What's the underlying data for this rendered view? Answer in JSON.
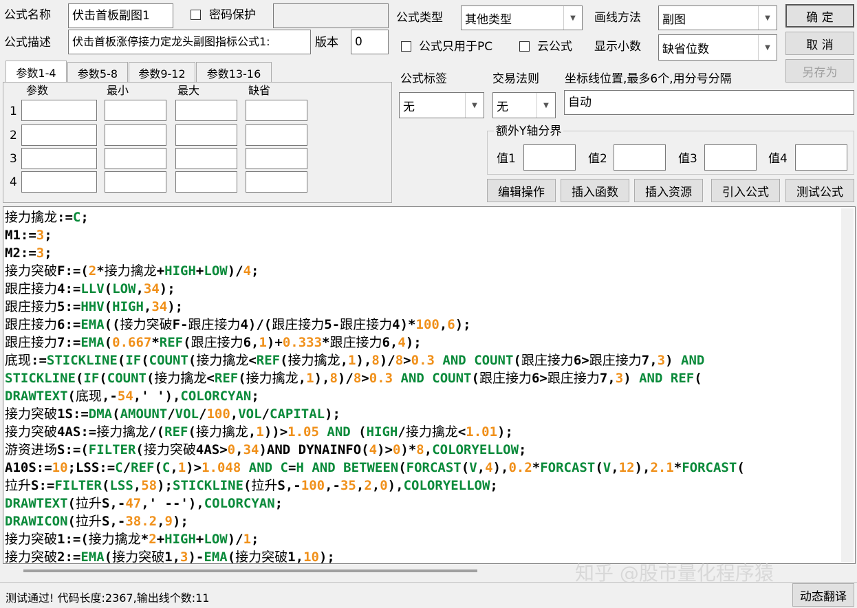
{
  "form": {
    "name_label": "公式名称",
    "name_value": "伏击首板副图1",
    "password_label": "密码保护",
    "desc_label": "公式描述",
    "desc_value": "伏击首板涨停接力定龙头副图指标公式1:",
    "version_label": "版本",
    "version_value": "0",
    "type_label": "公式类型",
    "type_value": "其他类型",
    "draw_label": "画线方法",
    "draw_value": "副图",
    "pc_only_label": "公式只用于PC",
    "cloud_label": "云公式",
    "decimal_label": "显示小数",
    "decimal_value": "缺省位数",
    "tag_label": "公式标签",
    "tag_value": "无",
    "trade_label": "交易法则",
    "trade_value": "无",
    "coord_label": "坐标线位置,最多6个,用分号分隔",
    "coord_value": "自动",
    "yaxis_title": "额外Y轴分界",
    "yaxis_labels": [
      "值1",
      "值2",
      "值3",
      "值4"
    ]
  },
  "buttons": {
    "ok": "确  定",
    "cancel": "取  消",
    "save_as": "另存为",
    "edit_ops": "编辑操作",
    "insert_func": "插入函数",
    "insert_res": "插入资源",
    "import_formula": "引入公式",
    "test_formula": "测试公式",
    "dynamic_translate": "动态翻译"
  },
  "params": {
    "tabs": [
      "参数1-4",
      "参数5-8",
      "参数9-12",
      "参数13-16"
    ],
    "headers": [
      "参数",
      "最小",
      "最大",
      "缺省"
    ],
    "rows": [
      "1",
      "2",
      "3",
      "4"
    ]
  },
  "code_lines": [
    [
      [
        "t",
        "接力擒龙"
      ],
      [
        "p",
        ":="
      ],
      [
        "k",
        "C"
      ],
      [
        "p",
        ";"
      ]
    ],
    [
      [
        "p",
        "M1:="
      ],
      [
        "n",
        "3"
      ],
      [
        "p",
        ";"
      ]
    ],
    [
      [
        "p",
        "M2:="
      ],
      [
        "n",
        "3"
      ],
      [
        "p",
        ";"
      ]
    ],
    [
      [
        "t",
        "接力突破"
      ],
      [
        "p",
        "F:=("
      ],
      [
        "n",
        "2"
      ],
      [
        "p",
        "*"
      ],
      [
        "t",
        "接力擒龙"
      ],
      [
        "p",
        "+"
      ],
      [
        "k",
        "HIGH"
      ],
      [
        "p",
        "+"
      ],
      [
        "k",
        "LOW"
      ],
      [
        "p",
        ")/"
      ],
      [
        "n",
        "4"
      ],
      [
        "p",
        ";"
      ]
    ],
    [
      [
        "t",
        "跟庄接力"
      ],
      [
        "p",
        "4:="
      ],
      [
        "k",
        "LLV"
      ],
      [
        "p",
        "("
      ],
      [
        "k",
        "LOW"
      ],
      [
        "p",
        ","
      ],
      [
        "n",
        "34"
      ],
      [
        "p",
        ");"
      ]
    ],
    [
      [
        "t",
        "跟庄接力"
      ],
      [
        "p",
        "5:="
      ],
      [
        "k",
        "HHV"
      ],
      [
        "p",
        "("
      ],
      [
        "k",
        "HIGH"
      ],
      [
        "p",
        ","
      ],
      [
        "n",
        "34"
      ],
      [
        "p",
        ");"
      ]
    ],
    [
      [
        "t",
        "跟庄接力"
      ],
      [
        "p",
        "6:="
      ],
      [
        "k",
        "EMA"
      ],
      [
        "p",
        "(("
      ],
      [
        "t",
        "接力突破"
      ],
      [
        "p",
        "F-"
      ],
      [
        "t",
        "跟庄接力"
      ],
      [
        "p",
        "4)/("
      ],
      [
        "t",
        "跟庄接力"
      ],
      [
        "p",
        "5-"
      ],
      [
        "t",
        "跟庄接力"
      ],
      [
        "p",
        "4)*"
      ],
      [
        "n",
        "100"
      ],
      [
        "p",
        ","
      ],
      [
        "n",
        "6"
      ],
      [
        "p",
        ");"
      ]
    ],
    [
      [
        "t",
        "跟庄接力"
      ],
      [
        "p",
        "7:="
      ],
      [
        "k",
        "EMA"
      ],
      [
        "p",
        "("
      ],
      [
        "n",
        "0.667"
      ],
      [
        "p",
        "*"
      ],
      [
        "k",
        "REF"
      ],
      [
        "p",
        "("
      ],
      [
        "t",
        "跟庄接力"
      ],
      [
        "p",
        "6,"
      ],
      [
        "n",
        "1"
      ],
      [
        "p",
        ")+"
      ],
      [
        "n",
        "0.333"
      ],
      [
        "p",
        "*"
      ],
      [
        "t",
        "跟庄接力"
      ],
      [
        "p",
        "6,"
      ],
      [
        "n",
        "4"
      ],
      [
        "p",
        ");"
      ]
    ],
    [
      [
        "t",
        "底现"
      ],
      [
        "p",
        ":="
      ],
      [
        "k",
        "STICKLINE"
      ],
      [
        "p",
        "("
      ],
      [
        "k",
        "IF"
      ],
      [
        "p",
        "("
      ],
      [
        "k",
        "COUNT"
      ],
      [
        "p",
        "("
      ],
      [
        "t",
        "接力擒龙"
      ],
      [
        "p",
        "<"
      ],
      [
        "k",
        "REF"
      ],
      [
        "p",
        "("
      ],
      [
        "t",
        "接力擒龙"
      ],
      [
        "p",
        ","
      ],
      [
        "n",
        "1"
      ],
      [
        "p",
        "),"
      ],
      [
        "n",
        "8"
      ],
      [
        "p",
        ")/"
      ],
      [
        "n",
        "8"
      ],
      [
        "p",
        ">"
      ],
      [
        "n",
        "0.3"
      ],
      [
        "p",
        " "
      ],
      [
        "k",
        "AND"
      ],
      [
        "p",
        " "
      ],
      [
        "k",
        "COUNT"
      ],
      [
        "p",
        "("
      ],
      [
        "t",
        "跟庄接力"
      ],
      [
        "p",
        "6>"
      ],
      [
        "t",
        "跟庄接力"
      ],
      [
        "p",
        "7,"
      ],
      [
        "n",
        "3"
      ],
      [
        "p",
        ") "
      ],
      [
        "k",
        "AND"
      ]
    ],
    [
      [
        "k",
        "STICKLINE"
      ],
      [
        "p",
        "("
      ],
      [
        "k",
        "IF"
      ],
      [
        "p",
        "("
      ],
      [
        "k",
        "COUNT"
      ],
      [
        "p",
        "("
      ],
      [
        "t",
        "接力擒龙"
      ],
      [
        "p",
        "<"
      ],
      [
        "k",
        "REF"
      ],
      [
        "p",
        "("
      ],
      [
        "t",
        "接力擒龙"
      ],
      [
        "p",
        ","
      ],
      [
        "n",
        "1"
      ],
      [
        "p",
        "),"
      ],
      [
        "n",
        "8"
      ],
      [
        "p",
        ")/"
      ],
      [
        "n",
        "8"
      ],
      [
        "p",
        ">"
      ],
      [
        "n",
        "0.3"
      ],
      [
        "p",
        " "
      ],
      [
        "k",
        "AND"
      ],
      [
        "p",
        " "
      ],
      [
        "k",
        "COUNT"
      ],
      [
        "p",
        "("
      ],
      [
        "t",
        "跟庄接力"
      ],
      [
        "p",
        "6>"
      ],
      [
        "t",
        "跟庄接力"
      ],
      [
        "p",
        "7,"
      ],
      [
        "n",
        "3"
      ],
      [
        "p",
        ") "
      ],
      [
        "k",
        "AND"
      ],
      [
        "p",
        " "
      ],
      [
        "k",
        "REF"
      ],
      [
        "p",
        "("
      ]
    ],
    [
      [
        "k",
        "DRAWTEXT"
      ],
      [
        "p",
        "("
      ],
      [
        "t",
        "底现"
      ],
      [
        "p",
        ",-"
      ],
      [
        "n",
        "54"
      ],
      [
        "p",
        ",' '),"
      ],
      [
        "k",
        "COLORCYAN"
      ],
      [
        "p",
        ";"
      ]
    ],
    [
      [
        "t",
        "接力突破"
      ],
      [
        "p",
        "1S:="
      ],
      [
        "k",
        "DMA"
      ],
      [
        "p",
        "("
      ],
      [
        "k",
        "AMOUNT"
      ],
      [
        "p",
        "/"
      ],
      [
        "k",
        "VOL"
      ],
      [
        "p",
        "/"
      ],
      [
        "n",
        "100"
      ],
      [
        "p",
        ","
      ],
      [
        "k",
        "VOL"
      ],
      [
        "p",
        "/"
      ],
      [
        "k",
        "CAPITAL"
      ],
      [
        "p",
        ");"
      ]
    ],
    [
      [
        "t",
        "接力突破"
      ],
      [
        "p",
        "4AS:="
      ],
      [
        "t",
        "接力擒龙"
      ],
      [
        "p",
        "/("
      ],
      [
        "k",
        "REF"
      ],
      [
        "p",
        "("
      ],
      [
        "t",
        "接力擒龙"
      ],
      [
        "p",
        ","
      ],
      [
        "n",
        "1"
      ],
      [
        "p",
        "))>"
      ],
      [
        "n",
        "1.05"
      ],
      [
        "p",
        " "
      ],
      [
        "k",
        "AND"
      ],
      [
        "p",
        " ("
      ],
      [
        "k",
        "HIGH"
      ],
      [
        "p",
        "/"
      ],
      [
        "t",
        "接力擒龙"
      ],
      [
        "p",
        "<"
      ],
      [
        "n",
        "1.01"
      ],
      [
        "p",
        ");"
      ]
    ],
    [
      [
        "t",
        "游资进场"
      ],
      [
        "p",
        "S:=("
      ],
      [
        "k",
        "FILTER"
      ],
      [
        "p",
        "("
      ],
      [
        "t",
        "接力突破"
      ],
      [
        "p",
        "4AS>"
      ],
      [
        "n",
        "0"
      ],
      [
        "p",
        ","
      ],
      [
        "n",
        "34"
      ],
      [
        "p",
        ")AND DYNAINFO("
      ],
      [
        "n",
        "4"
      ],
      [
        "p",
        ")>"
      ],
      [
        "n",
        "0"
      ],
      [
        "p",
        ")*"
      ],
      [
        "n",
        "8"
      ],
      [
        "p",
        ","
      ],
      [
        "k",
        "COLORYELLOW"
      ],
      [
        "p",
        ";"
      ]
    ],
    [
      [
        "p",
        "A10S:="
      ],
      [
        "n",
        "10"
      ],
      [
        "p",
        ";LSS:="
      ],
      [
        "k",
        "C"
      ],
      [
        "p",
        "/"
      ],
      [
        "k",
        "REF"
      ],
      [
        "p",
        "("
      ],
      [
        "k",
        "C"
      ],
      [
        "p",
        ","
      ],
      [
        "n",
        "1"
      ],
      [
        "p",
        ")>"
      ],
      [
        "n",
        "1.048"
      ],
      [
        "p",
        " "
      ],
      [
        "k",
        "AND"
      ],
      [
        "p",
        " "
      ],
      [
        "k",
        "C"
      ],
      [
        "p",
        "="
      ],
      [
        "k",
        "H"
      ],
      [
        "p",
        " "
      ],
      [
        "k",
        "AND"
      ],
      [
        "p",
        " "
      ],
      [
        "k",
        "BETWEEN"
      ],
      [
        "p",
        "("
      ],
      [
        "k",
        "FORCAST"
      ],
      [
        "p",
        "("
      ],
      [
        "k",
        "V"
      ],
      [
        "p",
        ","
      ],
      [
        "n",
        "4"
      ],
      [
        "p",
        "),"
      ],
      [
        "n",
        "0.2"
      ],
      [
        "p",
        "*"
      ],
      [
        "k",
        "FORCAST"
      ],
      [
        "p",
        "("
      ],
      [
        "k",
        "V"
      ],
      [
        "p",
        ","
      ],
      [
        "n",
        "12"
      ],
      [
        "p",
        "),"
      ],
      [
        "n",
        "2.1"
      ],
      [
        "p",
        "*"
      ],
      [
        "k",
        "FORCAST"
      ],
      [
        "p",
        "("
      ]
    ],
    [
      [
        "t",
        "拉升"
      ],
      [
        "p",
        "S:="
      ],
      [
        "k",
        "FILTER"
      ],
      [
        "p",
        "("
      ],
      [
        "k",
        "LSS"
      ],
      [
        "p",
        ","
      ],
      [
        "n",
        "58"
      ],
      [
        "p",
        ");"
      ],
      [
        "k",
        "STICKLINE"
      ],
      [
        "p",
        "("
      ],
      [
        "t",
        "拉升"
      ],
      [
        "p",
        "S,-"
      ],
      [
        "n",
        "100"
      ],
      [
        "p",
        ",-"
      ],
      [
        "n",
        "35"
      ],
      [
        "p",
        ","
      ],
      [
        "n",
        "2"
      ],
      [
        "p",
        ","
      ],
      [
        "n",
        "0"
      ],
      [
        "p",
        "),"
      ],
      [
        "k",
        "COLORYELLOW"
      ],
      [
        "p",
        ";"
      ]
    ],
    [
      [
        "k",
        "DRAWTEXT"
      ],
      [
        "p",
        "("
      ],
      [
        "t",
        "拉升"
      ],
      [
        "p",
        "S,-"
      ],
      [
        "n",
        "47"
      ],
      [
        "p",
        ",' --'),"
      ],
      [
        "k",
        "COLORCYAN"
      ],
      [
        "p",
        ";"
      ]
    ],
    [
      [
        "k",
        "DRAWICON"
      ],
      [
        "p",
        "("
      ],
      [
        "t",
        "拉升"
      ],
      [
        "p",
        "S,-"
      ],
      [
        "n",
        "38.2"
      ],
      [
        "p",
        ","
      ],
      [
        "n",
        "9"
      ],
      [
        "p",
        ");"
      ]
    ],
    [
      [
        "t",
        "接力突破"
      ],
      [
        "p",
        "1:=("
      ],
      [
        "t",
        "接力擒龙"
      ],
      [
        "p",
        "*"
      ],
      [
        "n",
        "2"
      ],
      [
        "p",
        "+"
      ],
      [
        "k",
        "HIGH"
      ],
      [
        "p",
        "+"
      ],
      [
        "k",
        "LOW"
      ],
      [
        "p",
        ")/"
      ],
      [
        "n",
        "1"
      ],
      [
        "p",
        ";"
      ]
    ],
    [
      [
        "t",
        "接力突破"
      ],
      [
        "p",
        "2:="
      ],
      [
        "k",
        "EMA"
      ],
      [
        "p",
        "("
      ],
      [
        "t",
        "接力突破"
      ],
      [
        "p",
        "1,"
      ],
      [
        "n",
        "3"
      ],
      [
        "p",
        ")-"
      ],
      [
        "k",
        "EMA"
      ],
      [
        "p",
        "("
      ],
      [
        "t",
        "接力突破"
      ],
      [
        "p",
        "1,"
      ],
      [
        "n",
        "10"
      ],
      [
        "p",
        ");"
      ]
    ]
  ],
  "colors": {
    "keyword": "#0a8a3a",
    "number": "#f0901a",
    "plain": "#000000"
  },
  "watermark": "知乎 @股市量化程序猿",
  "status_text": "测试通过! 代码长度:2367,输出线个数:11"
}
